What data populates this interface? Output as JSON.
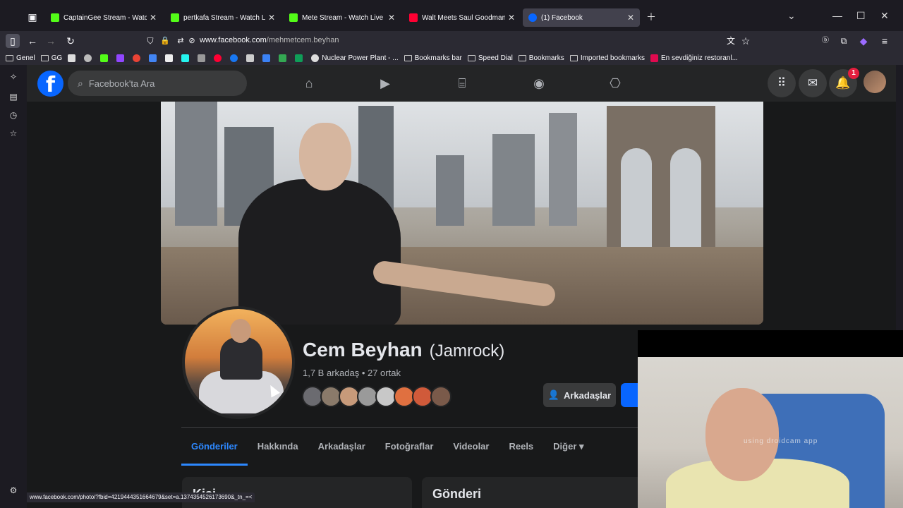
{
  "browser": {
    "tabs": [
      {
        "title": "CaptainGee Stream - Watch Live",
        "favicon_color": "#53fc18"
      },
      {
        "title": "pertkafa Stream - Watch Live o",
        "favicon_color": "#53fc18"
      },
      {
        "title": "Mete Stream - Watch Live on K",
        "favicon_color": "#53fc18"
      },
      {
        "title": "Walt Meets Saul Goodman For",
        "favicon_color": "#ff0033"
      },
      {
        "title": "(1) Facebook",
        "favicon_color": "#0866ff"
      }
    ],
    "url_host": "www.facebook.com",
    "url_path": "/mehmetcem.beyhan",
    "bookmarks": [
      {
        "label": "Genel",
        "type": "folder"
      },
      {
        "label": "GG",
        "type": "folder"
      },
      {
        "label": "Nuclear Power Plant - ...",
        "type": "site"
      },
      {
        "label": "Bookmarks bar",
        "type": "folder"
      },
      {
        "label": "Speed Dial",
        "type": "folder"
      },
      {
        "label": "Bookmarks",
        "type": "folder"
      },
      {
        "label": "Imported bookmarks",
        "type": "folder"
      },
      {
        "label": "En sevdiğiniz restoranl...",
        "type": "site"
      }
    ],
    "status_url": "www.facebook.com/photo/?fbid=4219444351664679&set=a.1374354526173690&_tn_=<"
  },
  "facebook": {
    "search_placeholder": "Facebook'ta Ara",
    "notification_count": "1",
    "profile": {
      "name": "Cem Beyhan",
      "alt_name": "(Jamrock)",
      "stats": "1,7 B arkadaş • 27 ortak",
      "friends_button": "Arkadaşlar"
    },
    "tabs": [
      "Gönderiler",
      "Hakkında",
      "Arkadaşlar",
      "Fotoğraflar",
      "Videolar",
      "Reels",
      "Diğer ▾"
    ],
    "cards": {
      "left_title": "Kişi",
      "right_title": "Gönderi"
    }
  },
  "webcam": {
    "watermark": "using droidcam app"
  }
}
